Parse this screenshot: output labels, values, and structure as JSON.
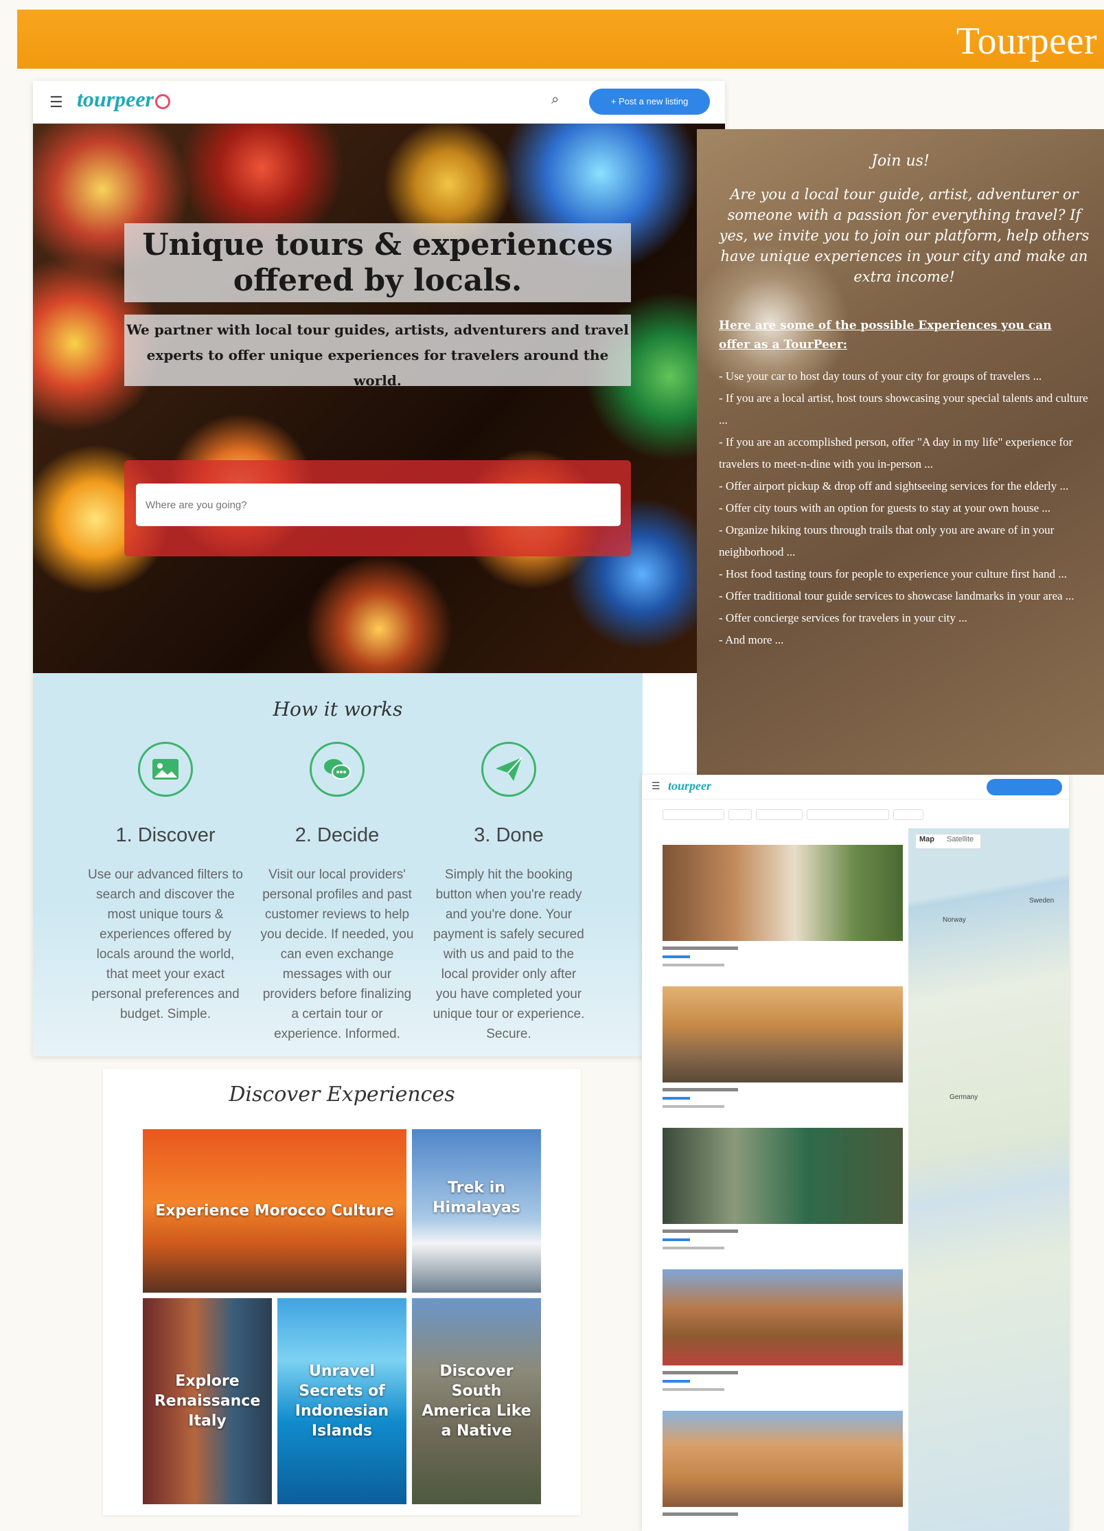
{
  "banner": {
    "brand": "Tourpeer"
  },
  "nav": {
    "logo": "tourpeer",
    "post_label": "+ Post a new listing"
  },
  "hero": {
    "title": "Unique tours & experiences offered by locals.",
    "subtitle": "We partner with local tour guides, artists, adventurers and travel experts to offer unique experiences for travelers around the world.",
    "search_placeholder": "Where are you going?"
  },
  "how": {
    "title": "How it works",
    "steps": [
      {
        "title": "1. Discover",
        "icon": "image-icon",
        "text": "Use our advanced filters to search and discover the most unique tours & experiences offered by locals around the world, that meet your exact personal preferences and budget. Simple."
      },
      {
        "title": "2. Decide",
        "icon": "chat-icon",
        "text": "Visit our local providers' personal profiles and past customer reviews to help you decide. If needed, you can even exchange messages with our providers before finalizing a certain tour or experience. Informed."
      },
      {
        "title": "3. Done",
        "icon": "paper-plane-icon",
        "text": "Simply hit the booking button when you're ready and you're done. Your payment is safely secured with us and paid to the local provider only after you have completed your unique tour or experience. Secure."
      }
    ]
  },
  "join": {
    "title": "Join us!",
    "description": "Are you a local tour guide, artist, adventurer or someone with a passion for everything travel? If yes, we invite you to join our platform, help others have unique experiences in your city and make an extra income!",
    "heading": "Here are some of the possible Experiences you can offer as a TourPeer:",
    "items": [
      "- Use your car to host day tours of your city for groups of travelers ...",
      "- If you are a local artist, host tours showcasing your special talents and culture ...",
      "- If you are an accomplished person, offer \"A day in my life\" experience for travelers to meet-n-dine with you in-person ...",
      "- Offer airport pickup & drop off and sightseeing services for the elderly ...",
      "- Offer city tours with an option for guests to stay at your own house ...",
      "- Organize hiking tours through trails that only you are aware of in your neighborhood ...",
      "- Host food tasting tours for people to experience your culture first hand ...",
      "- Offer traditional tour guide services to showcase landmarks in your area ...",
      "- Offer concierge services for travelers in your city ...",
      "- And more ..."
    ]
  },
  "discover": {
    "title": "Discover Experiences",
    "tiles": [
      {
        "label": "Experience Morocco Culture"
      },
      {
        "label": "Trek in Himalayas"
      },
      {
        "label": "Explore Renaissance Italy"
      },
      {
        "label": "Unravel Secrets of Indonesian Islands"
      },
      {
        "label": "Discover South America Like a Native"
      }
    ]
  },
  "results": {
    "logo": "tourpeer",
    "map_tabs": [
      "Map",
      "Satellite"
    ],
    "map_labels": [
      "Sweden",
      "Norway",
      "Germany"
    ]
  },
  "colors": {
    "banner": "#f59f14",
    "accent": "#2f86e6",
    "brand": "#1fa9b6",
    "step_icon": "#3cb36b"
  }
}
